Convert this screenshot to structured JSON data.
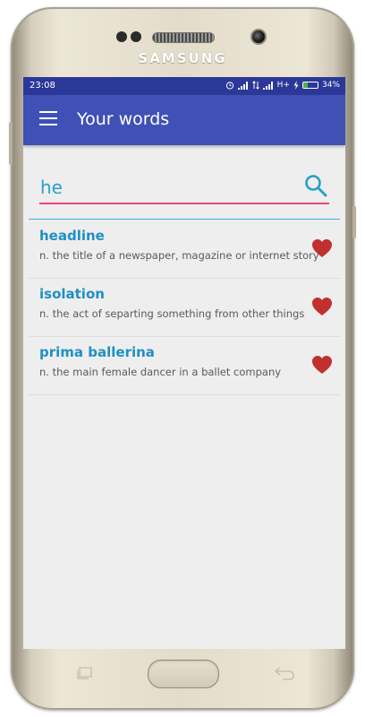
{
  "device": {
    "brand": "SAMSUNG"
  },
  "status_bar": {
    "time": "23:08",
    "network": "H+",
    "battery_percent": "34%",
    "battery_level": 0.34,
    "icons": [
      "alarm-icon",
      "signal-icon",
      "data-arrows-icon",
      "signal-icon",
      "charging-icon",
      "battery-icon"
    ]
  },
  "app_bar": {
    "title": "Your words",
    "menu_icon": "hamburger-menu-icon",
    "color": "#3f51b5"
  },
  "search": {
    "value": "he",
    "icon": "search-icon",
    "underline_color": "#e8457a"
  },
  "words": [
    {
      "term": "headline",
      "definition": "n. the title of a newspaper, magazine or internet story",
      "favorite": true
    },
    {
      "term": "isolation",
      "definition": "n. the act of separting something from other things",
      "favorite": true
    },
    {
      "term": "prima ballerina",
      "definition": "n. the main female dancer in a ballet company",
      "favorite": true
    }
  ],
  "colors": {
    "term": "#1f8fc4",
    "heart": "#c0302e",
    "status_bar": "#2c3898"
  },
  "nav_buttons": [
    "recent-apps-icon",
    "home-button",
    "back-icon"
  ]
}
